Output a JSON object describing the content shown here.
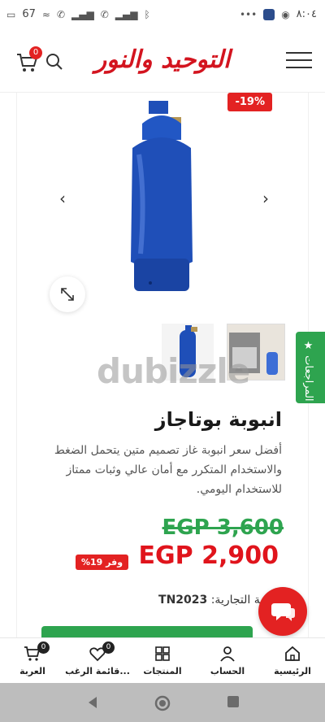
{
  "status_bar": {
    "time": "٨:٠٤",
    "battery": "67"
  },
  "header": {
    "logo_text": "التوحيد والنور",
    "cart_count": "0"
  },
  "product": {
    "discount_badge": "-19%",
    "title": "انبوبة بوتاجاز",
    "description": "أفضل سعر انبوبة غاز تصميم متين يتحمل الضغط والاستخدام المتكرر مع أمان عالي وثبات ممتاز للاستخدام اليومي.",
    "old_price": "EGP 3,600",
    "new_price": "EGP 2,900",
    "save_badge": "وفر 19%",
    "sku_label": "العلامة التجارية:",
    "sku_value": "TN2023",
    "watermark": "dubizzle"
  },
  "reviews_tab": {
    "label": "★ المراجعات"
  },
  "bottom_nav": {
    "items": [
      {
        "label": "الرئيسية",
        "icon": "home-icon"
      },
      {
        "label": "الحساب",
        "icon": "user-icon"
      },
      {
        "label": "المنتجات",
        "icon": "grid-icon"
      },
      {
        "label": "قائمة الرغب...",
        "icon": "heart-icon",
        "badge": "0"
      },
      {
        "label": "العربة",
        "icon": "cart-icon",
        "badge": "0"
      }
    ]
  },
  "colors": {
    "brand_red": "#e32222",
    "accent_green": "#2ea44f",
    "cylinder_blue": "#1f4fb8"
  }
}
